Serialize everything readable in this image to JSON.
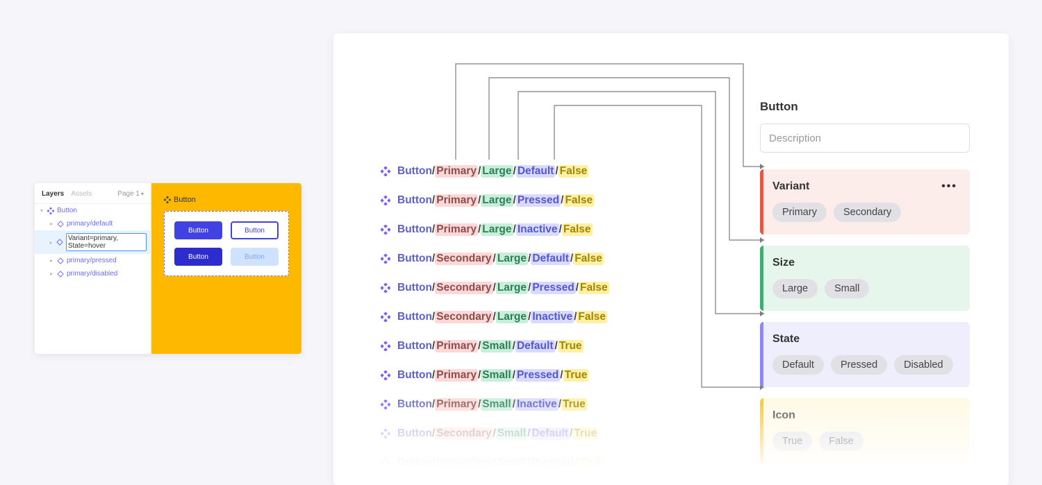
{
  "mini": {
    "tabs": {
      "layers": "Layers",
      "assets": "Assets",
      "page": "Page 1"
    },
    "layers": {
      "root": "Button",
      "items": [
        "primary/default",
        "Variant=primary, State=hover",
        "primary/pressed",
        "primary/disabled"
      ]
    },
    "canvas_label": "Button",
    "buttons": [
      "Button",
      "Button",
      "Button",
      "Button"
    ]
  },
  "big": {
    "header_title": "Button",
    "description_placeholder": "Description",
    "rows": [
      {
        "base": "Button",
        "variant": "Primary",
        "size": "Large",
        "state": "Default",
        "icon": "False"
      },
      {
        "base": "Button",
        "variant": "Primary",
        "size": "Large",
        "state": "Pressed",
        "icon": "False"
      },
      {
        "base": "Button",
        "variant": "Primary",
        "size": "Large",
        "state": "Inactive",
        "icon": "False"
      },
      {
        "base": "Button",
        "variant": "Secondary",
        "size": "Large",
        "state": "Default",
        "icon": "False"
      },
      {
        "base": "Button",
        "variant": "Secondary",
        "size": "Large",
        "state": "Pressed",
        "icon": "False"
      },
      {
        "base": "Button",
        "variant": "Secondary",
        "size": "Large",
        "state": "Inactive",
        "icon": "False"
      },
      {
        "base": "Button",
        "variant": "Primary",
        "size": "Small",
        "state": "Default",
        "icon": "True"
      },
      {
        "base": "Button",
        "variant": "Primary",
        "size": "Small",
        "state": "Pressed",
        "icon": "True"
      },
      {
        "base": "Button",
        "variant": "Primary",
        "size": "Small",
        "state": "Inactive",
        "icon": "True"
      },
      {
        "base": "Button",
        "variant": "Secondary",
        "size": "Small",
        "state": "Default",
        "icon": "True"
      },
      {
        "base": "Button",
        "variant": "Secondary",
        "size": "Small",
        "state": "Pressed",
        "icon": "True"
      }
    ],
    "props": {
      "variant": {
        "title": "Variant",
        "chips": [
          "Primary",
          "Secondary"
        ]
      },
      "size": {
        "title": "Size",
        "chips": [
          "Large",
          "Small"
        ]
      },
      "state": {
        "title": "State",
        "chips": [
          "Default",
          "Pressed",
          "Disabled"
        ]
      },
      "icon": {
        "title": "Icon",
        "chips": [
          "True",
          "False"
        ]
      }
    }
  }
}
